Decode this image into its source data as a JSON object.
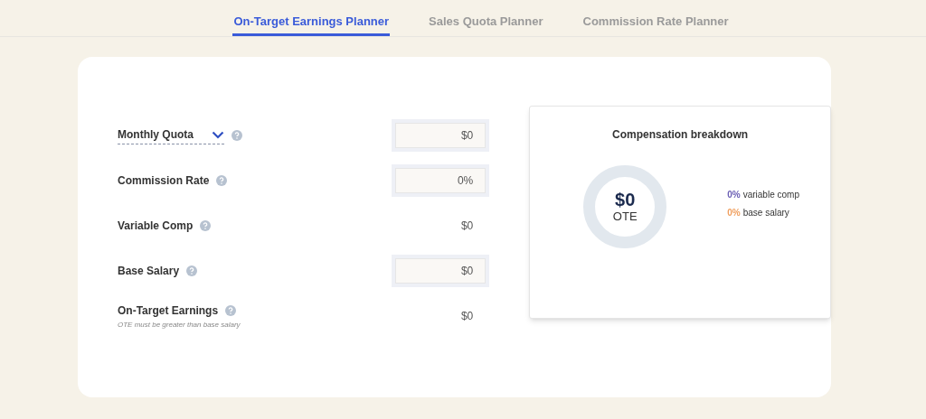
{
  "tabs": [
    {
      "label": "On-Target Earnings Planner",
      "selected": true
    },
    {
      "label": "Sales Quota Planner",
      "selected": false
    },
    {
      "label": "Commission Rate Planner",
      "selected": false
    }
  ],
  "fields": [
    {
      "kind": "input",
      "label": "Monthly Quota",
      "dropdown": true,
      "value": "$0"
    },
    {
      "kind": "input",
      "label": "Commission Rate",
      "value": "0%"
    },
    {
      "kind": "output",
      "label": "Variable Comp",
      "value": "$0"
    },
    {
      "kind": "input",
      "label": "Base Salary",
      "value": "$0"
    },
    {
      "kind": "output",
      "label": "On-Target Earnings",
      "note": "OTE must be greater than base salary",
      "value": "$0"
    }
  ],
  "breakdown": {
    "title": "Compensation breakdown",
    "total": "$0",
    "total_label": "OTE",
    "legend": [
      {
        "percent": "0%",
        "label": "variable comp",
        "color": "#6b5fb5"
      },
      {
        "percent": "0%",
        "label": "base salary",
        "color": "#f0a060"
      }
    ]
  }
}
